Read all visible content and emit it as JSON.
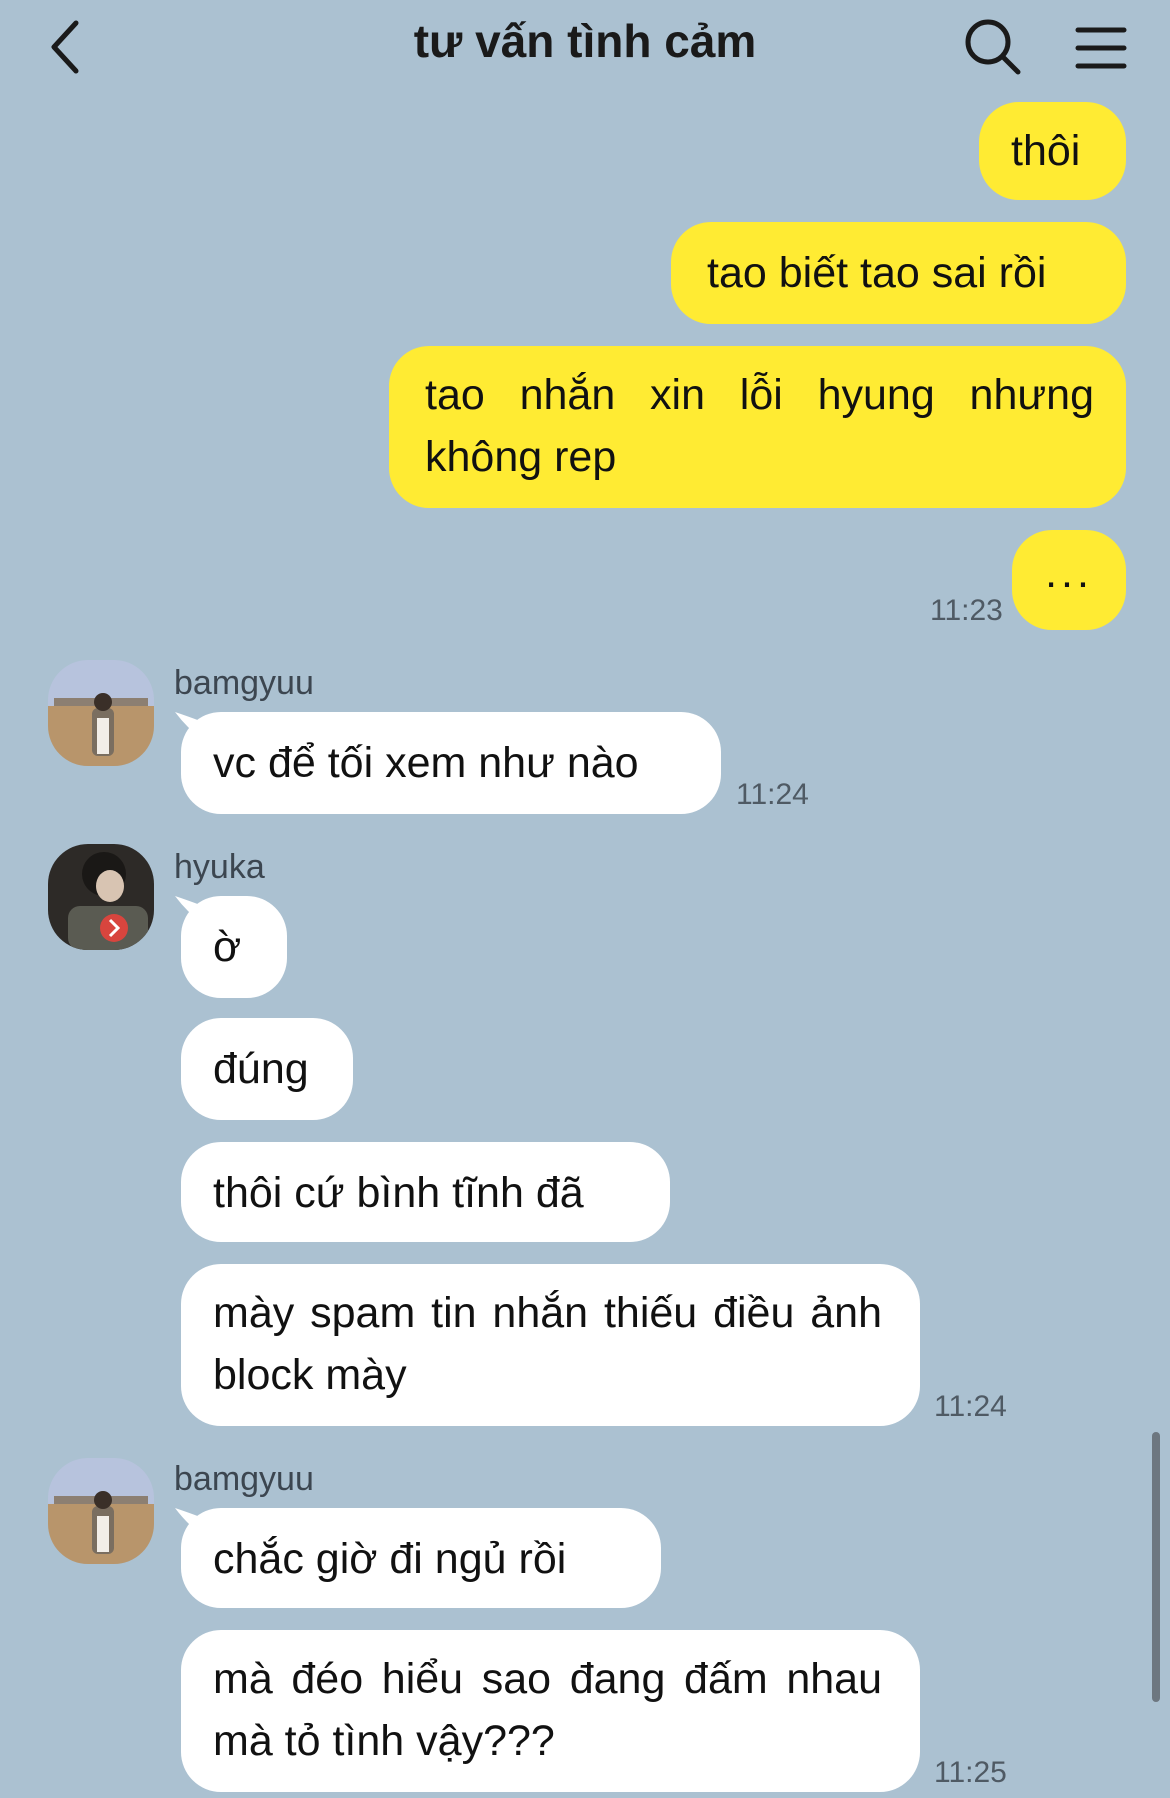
{
  "header": {
    "title": "tư vấn tình cảm",
    "back_icon": "chevron-left-icon",
    "search_icon": "search-icon",
    "menu_icon": "hamburger-menu-icon"
  },
  "messages": {
    "m1": "thôi",
    "m2": "tao biết tao sai rồi",
    "m3": "tao nhắn xin lỗi hyung nhưng không rep",
    "m4": "...",
    "t1": "11:23",
    "sender1": "bamgyuu",
    "m5": "vc để tối xem như nào",
    "t2": "11:24",
    "sender2": "hyuka",
    "m6": "ờ",
    "m7": "đúng",
    "m8": "thôi cứ bình tĩnh đã",
    "m9": "mày spam tin nhắn thiếu điều ảnh block mày",
    "t3": "11:24",
    "sender3": "bamgyuu",
    "m10": "chắc giờ đi ngủ rồi",
    "m11": "mà đéo hiểu sao đang đấm nhau mà tỏ tình vậy???",
    "t4": "11:25"
  },
  "colors": {
    "background": "#abc1d1",
    "my_bubble": "#ffeb33",
    "other_bubble": "#ffffff"
  }
}
